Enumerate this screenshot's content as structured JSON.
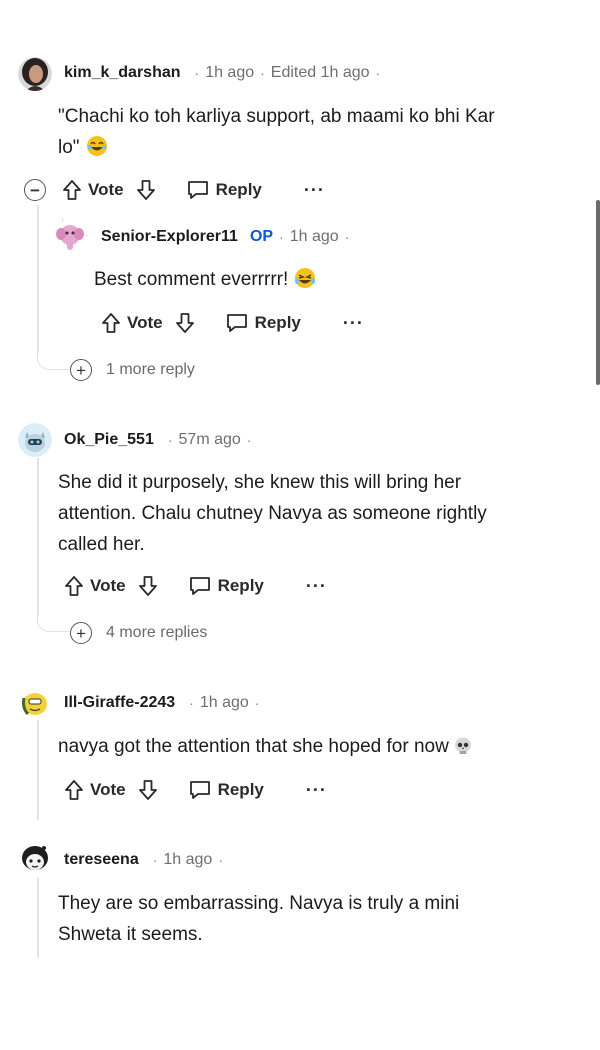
{
  "comments": [
    {
      "username": "kim_k_darshan",
      "time": "1h ago",
      "edited": "Edited 1h ago",
      "text_lines": [
        "\"Chachi ko toh karliya support, ab maami ko bhi Kar",
        "lo\""
      ],
      "avatar": "girl-dark-hair-avatar",
      "emoji": "laughing-emoji"
    },
    {
      "username": "Senior-Explorer11",
      "op_badge": "OP",
      "time": "1h ago",
      "text": "Best comment everrrrr!",
      "avatar": "pink-elephant-avatar",
      "emoji": "crying-laughing-emoji"
    },
    {
      "username": "Ok_Pie_551",
      "time": "57m ago",
      "text_lines": [
        "She did it purposely, she knew this will bring her",
        "attention. Chalu chutney Navya as someone rightly",
        "called her."
      ],
      "avatar": "robot-cat-avatar"
    },
    {
      "username": "Ill-Giraffe-2243",
      "time": "1h ago",
      "text": "navya got the attention that she hoped for now",
      "avatar": "yellow-snoo-avatar",
      "emoji": "skull-emoji"
    },
    {
      "username": "tereseena",
      "time": "1h ago",
      "text_lines": [
        "They are so embarrassing. Navya is truly a mini",
        "Shweta it seems."
      ],
      "avatar": "dark-hair-snoo-avatar"
    }
  ],
  "actions": {
    "vote": "Vote",
    "reply": "Reply",
    "more": "···"
  },
  "more_replies": [
    "1 more reply",
    "4 more replies"
  ],
  "collapse_symbol": "−",
  "expand_symbol": "+",
  "separator": "·",
  "colors": {
    "op_blue": "#0a5bc7",
    "thread_line": "#e3e3e3",
    "text": "#1c1c1c",
    "meta_gray": "#6f6f6f"
  }
}
